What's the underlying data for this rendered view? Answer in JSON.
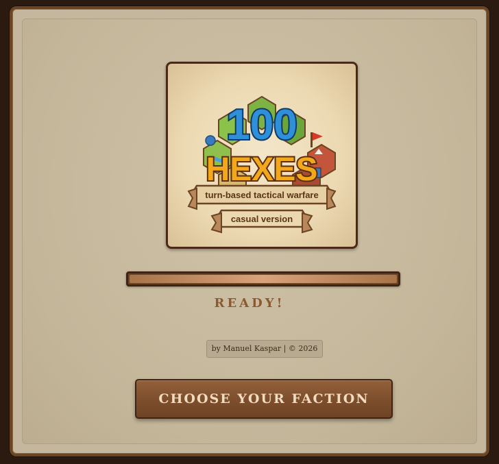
{
  "logo": {
    "number": "100",
    "word": "HEXES",
    "tagline": "turn-based tactical warfare",
    "edition": "casual version"
  },
  "loading": {
    "progress": 1.0,
    "status": "READY!"
  },
  "credit": "by Manuel Kaspar | © 2026",
  "actions": {
    "choose_faction_label": "CHOOSE YOUR FACTION"
  },
  "colors": {
    "frame": "#6b4424",
    "panel": "#c5b79d",
    "accent": "#8a5a32",
    "button": "#7c4e2c",
    "button_text": "#f1dcc0"
  }
}
